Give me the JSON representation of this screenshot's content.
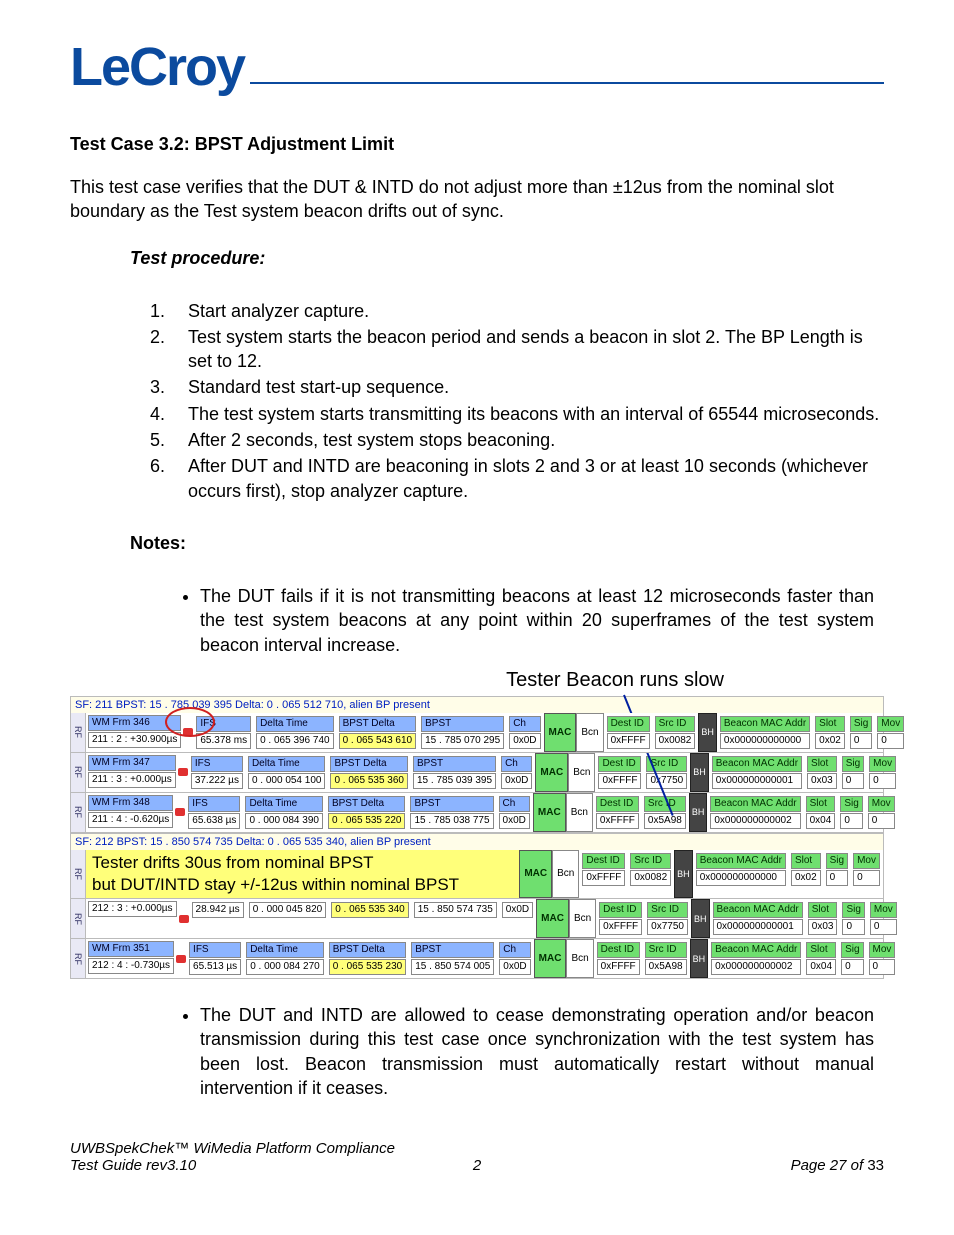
{
  "brand": {
    "part1": "Le",
    "part2": "Croy"
  },
  "heading": "Test Case 3.2: BPST Adjustment Limit",
  "intro": "This test case verifies that the DUT & INTD do not adjust more than ±12us from the nominal slot boundary as the Test system beacon drifts out of sync.",
  "procedure_label": "Test procedure:",
  "procedure": [
    "Start analyzer capture.",
    "Test system starts the beacon period and sends a beacon in slot 2. The BP Length is set to 12.",
    "Standard test start-up sequence.",
    "The test system starts transmitting its beacons with an interval of 65544 microseconds.",
    "After 2 seconds, test system stops beaconing.",
    "After DUT and INTD are beaconing in slots 2 and 3 or at least 10 seconds (whichever occurs first), stop analyzer capture."
  ],
  "notes_label": "Notes:",
  "note1": "The DUT fails if it is not transmitting beacons at least 12 microseconds faster than the test system beacons at any point within 20 superframes of the test system beacon interval increase.",
  "note2": "The DUT and INTD are allowed to cease demonstrating operation and/or beacon transmission during this test case once synchronization with the test system has been lost.  Beacon transmission must automatically restart without manual intervention if it ceases.",
  "annotation_top": "Tester Beacon runs slow",
  "drift_line1": "Tester drifts 30us from nominal BPST",
  "drift_line2": "but DUT/INTD stay +/-12us within nominal BPST",
  "sf_headers": [
    "SF: 211   BPST: 15 . 785 039 395   Delta: 0 . 065 512 710, alien BP present",
    "SF: 212   BPST: 15 . 850 574 735   Delta: 0 . 065 535 340, alien BP present"
  ],
  "col_labels": {
    "ifs": "IFS",
    "delta_time": "Delta Time",
    "bpst_delta": "BPST Delta",
    "bpst": "BPST",
    "ch": "Ch",
    "dest_id": "Dest ID",
    "src_id": "Src ID",
    "mac_addr": "Beacon MAC Addr",
    "slot": "Slot",
    "sig": "Sig",
    "mov": "Mov",
    "mac": "MAC",
    "bcn": "Bcn",
    "bh": "BH",
    "rf": "RF"
  },
  "frames": [
    {
      "wm": "WM Frm 346",
      "slotinfo": "211 : 2 : +30.900µs",
      "ifs": "65.378 ms",
      "delta": "0 . 065 396 740",
      "bpst_delta": "0 . 065 543 610",
      "bpst": "15 . 785 070 295",
      "ch": "0x0D",
      "dest": "0xFFFF",
      "src": "0x0082",
      "mac_addr": "0x000000000000",
      "slot": "0x02",
      "sig": "0",
      "mov": "0"
    },
    {
      "wm": "WM Frm 347",
      "slotinfo": "211 : 3 : +0.000µs",
      "ifs": "37.222 µs",
      "delta": "0 . 000 054 100",
      "bpst_delta": "0 . 065 535 360",
      "bpst": "15 . 785 039 395",
      "ch": "0x0D",
      "dest": "0xFFFF",
      "src": "0x7750",
      "mac_addr": "0x000000000001",
      "slot": "0x03",
      "sig": "0",
      "mov": "0"
    },
    {
      "wm": "WM Frm 348",
      "slotinfo": "211 : 4 : -0.620µs",
      "ifs": "65.638 µs",
      "delta": "0 . 000 084 390",
      "bpst_delta": "0 . 065 535 220",
      "bpst": "15 . 785 038 775",
      "ch": "0x0D",
      "dest": "0xFFFF",
      "src": "0x5A98",
      "mac_addr": "0x000000000002",
      "slot": "0x04",
      "sig": "0",
      "mov": "0"
    }
  ],
  "frames2pre": {
    "dest": "0xFFFF",
    "src": "0x0082",
    "mac_addr": "0x000000000000",
    "slot": "0x02",
    "sig": "0",
    "mov": "0"
  },
  "frames2": [
    {
      "wm": "",
      "slotinfo": "212 : 3 : +0.000µs",
      "ifs": "28.942 µs",
      "delta": "0 . 000 045 820",
      "bpst_delta": "0 . 065 535 340",
      "bpst": "15 . 850 574 735",
      "ch": "0x0D",
      "dest": "0xFFFF",
      "src": "0x7750",
      "mac_addr": "0x000000000001",
      "slot": "0x03",
      "sig": "0",
      "mov": "0"
    },
    {
      "wm": "WM Frm 351",
      "slotinfo": "212 : 4 : -0.730µs",
      "ifs": "65.513 µs",
      "delta": "0 . 000 084 270",
      "bpst_delta": "0 . 065 535 230",
      "bpst": "15 . 850 574 005",
      "ch": "0x0D",
      "dest": "0xFFFF",
      "src": "0x5A98",
      "mac_addr": "0x000000000002",
      "slot": "0x04",
      "sig": "0",
      "mov": "0"
    }
  ],
  "footer": {
    "left1": "UWBSpekChek™ WiMedia Platform Compliance",
    "left2": "Test Guide rev3.10",
    "center": "2",
    "right_prefix": "Page 27 of ",
    "right_total": "33"
  }
}
